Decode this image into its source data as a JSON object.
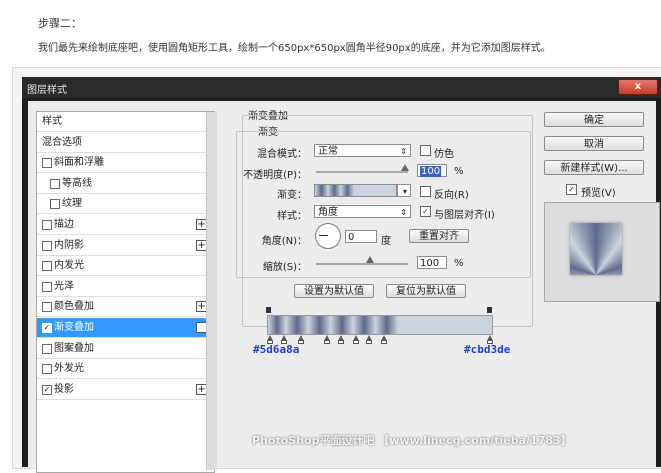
{
  "article": {
    "step": "步骤二：",
    "paragraph": "我们最先来绘制底座吧，使用圆角矩形工具，绘制一个650px*650px圆角半径90px的底座，并为它添加图层样式。"
  },
  "dialog": {
    "title": "图层样式",
    "close": "x"
  },
  "style_list": [
    {
      "label": "样式",
      "check": false,
      "plus": false,
      "sub": false,
      "selected": false
    },
    {
      "label": "混合选项",
      "check": false,
      "plus": false,
      "sub": false,
      "selected": false
    },
    {
      "label": "斜面和浮雕",
      "check": true,
      "checked": false,
      "plus": false,
      "sub": false,
      "selected": false
    },
    {
      "label": "等高线",
      "check": true,
      "checked": false,
      "plus": false,
      "sub": true,
      "selected": false
    },
    {
      "label": "纹理",
      "check": true,
      "checked": false,
      "plus": false,
      "sub": true,
      "selected": false
    },
    {
      "label": "描边",
      "check": true,
      "checked": false,
      "plus": true,
      "sub": false,
      "selected": false
    },
    {
      "label": "内阴影",
      "check": true,
      "checked": false,
      "plus": true,
      "sub": false,
      "selected": false
    },
    {
      "label": "内发光",
      "check": true,
      "checked": false,
      "plus": false,
      "sub": false,
      "selected": false
    },
    {
      "label": "光泽",
      "check": true,
      "checked": false,
      "plus": false,
      "sub": false,
      "selected": false
    },
    {
      "label": "颜色叠加",
      "check": true,
      "checked": false,
      "plus": true,
      "sub": false,
      "selected": false
    },
    {
      "label": "渐变叠加",
      "check": true,
      "checked": true,
      "plus": true,
      "sub": false,
      "selected": true
    },
    {
      "label": "图案叠加",
      "check": true,
      "checked": false,
      "plus": false,
      "sub": false,
      "selected": false
    },
    {
      "label": "外发光",
      "check": true,
      "checked": false,
      "plus": false,
      "sub": false,
      "selected": false
    },
    {
      "label": "投影",
      "check": true,
      "checked": true,
      "plus": true,
      "sub": false,
      "selected": false
    }
  ],
  "gradient_overlay": {
    "section_title": "渐变叠加",
    "group_title": "渐变",
    "blend_mode_label": "混合模式：",
    "blend_mode": "正常",
    "dither_label": "仿色",
    "dither_checked": false,
    "opacity_label": "不透明度(P)：",
    "opacity": "100",
    "percent": "%",
    "gradient_label": "渐变：",
    "reverse_label": "反向(R)",
    "reverse_checked": false,
    "style_label": "样式：",
    "style": "角度",
    "align_label": "与图层对齐(I)",
    "align_checked": true,
    "angle_label": "角度(N)：",
    "angle": "0",
    "degree": "度",
    "reset_align": "重置对齐",
    "scale_label": "缩放(S)：",
    "scale": "100",
    "set_default": "设置为默认值",
    "reset_default": "复位为默认值"
  },
  "gradient_editor": {
    "color_start": "#5d6a8a",
    "color_end": "#cbd3de",
    "color_start_label": "#5d6a8a",
    "color_end_label": "#cbd3de"
  },
  "buttons": {
    "ok": "确定",
    "cancel": "取消",
    "new_style": "新建样式(W)...",
    "preview_label": "预览(V)",
    "preview_checked": true
  },
  "watermark": "PhotoShop平面设计吧 【www.linecg.com/tieba/1783】"
}
